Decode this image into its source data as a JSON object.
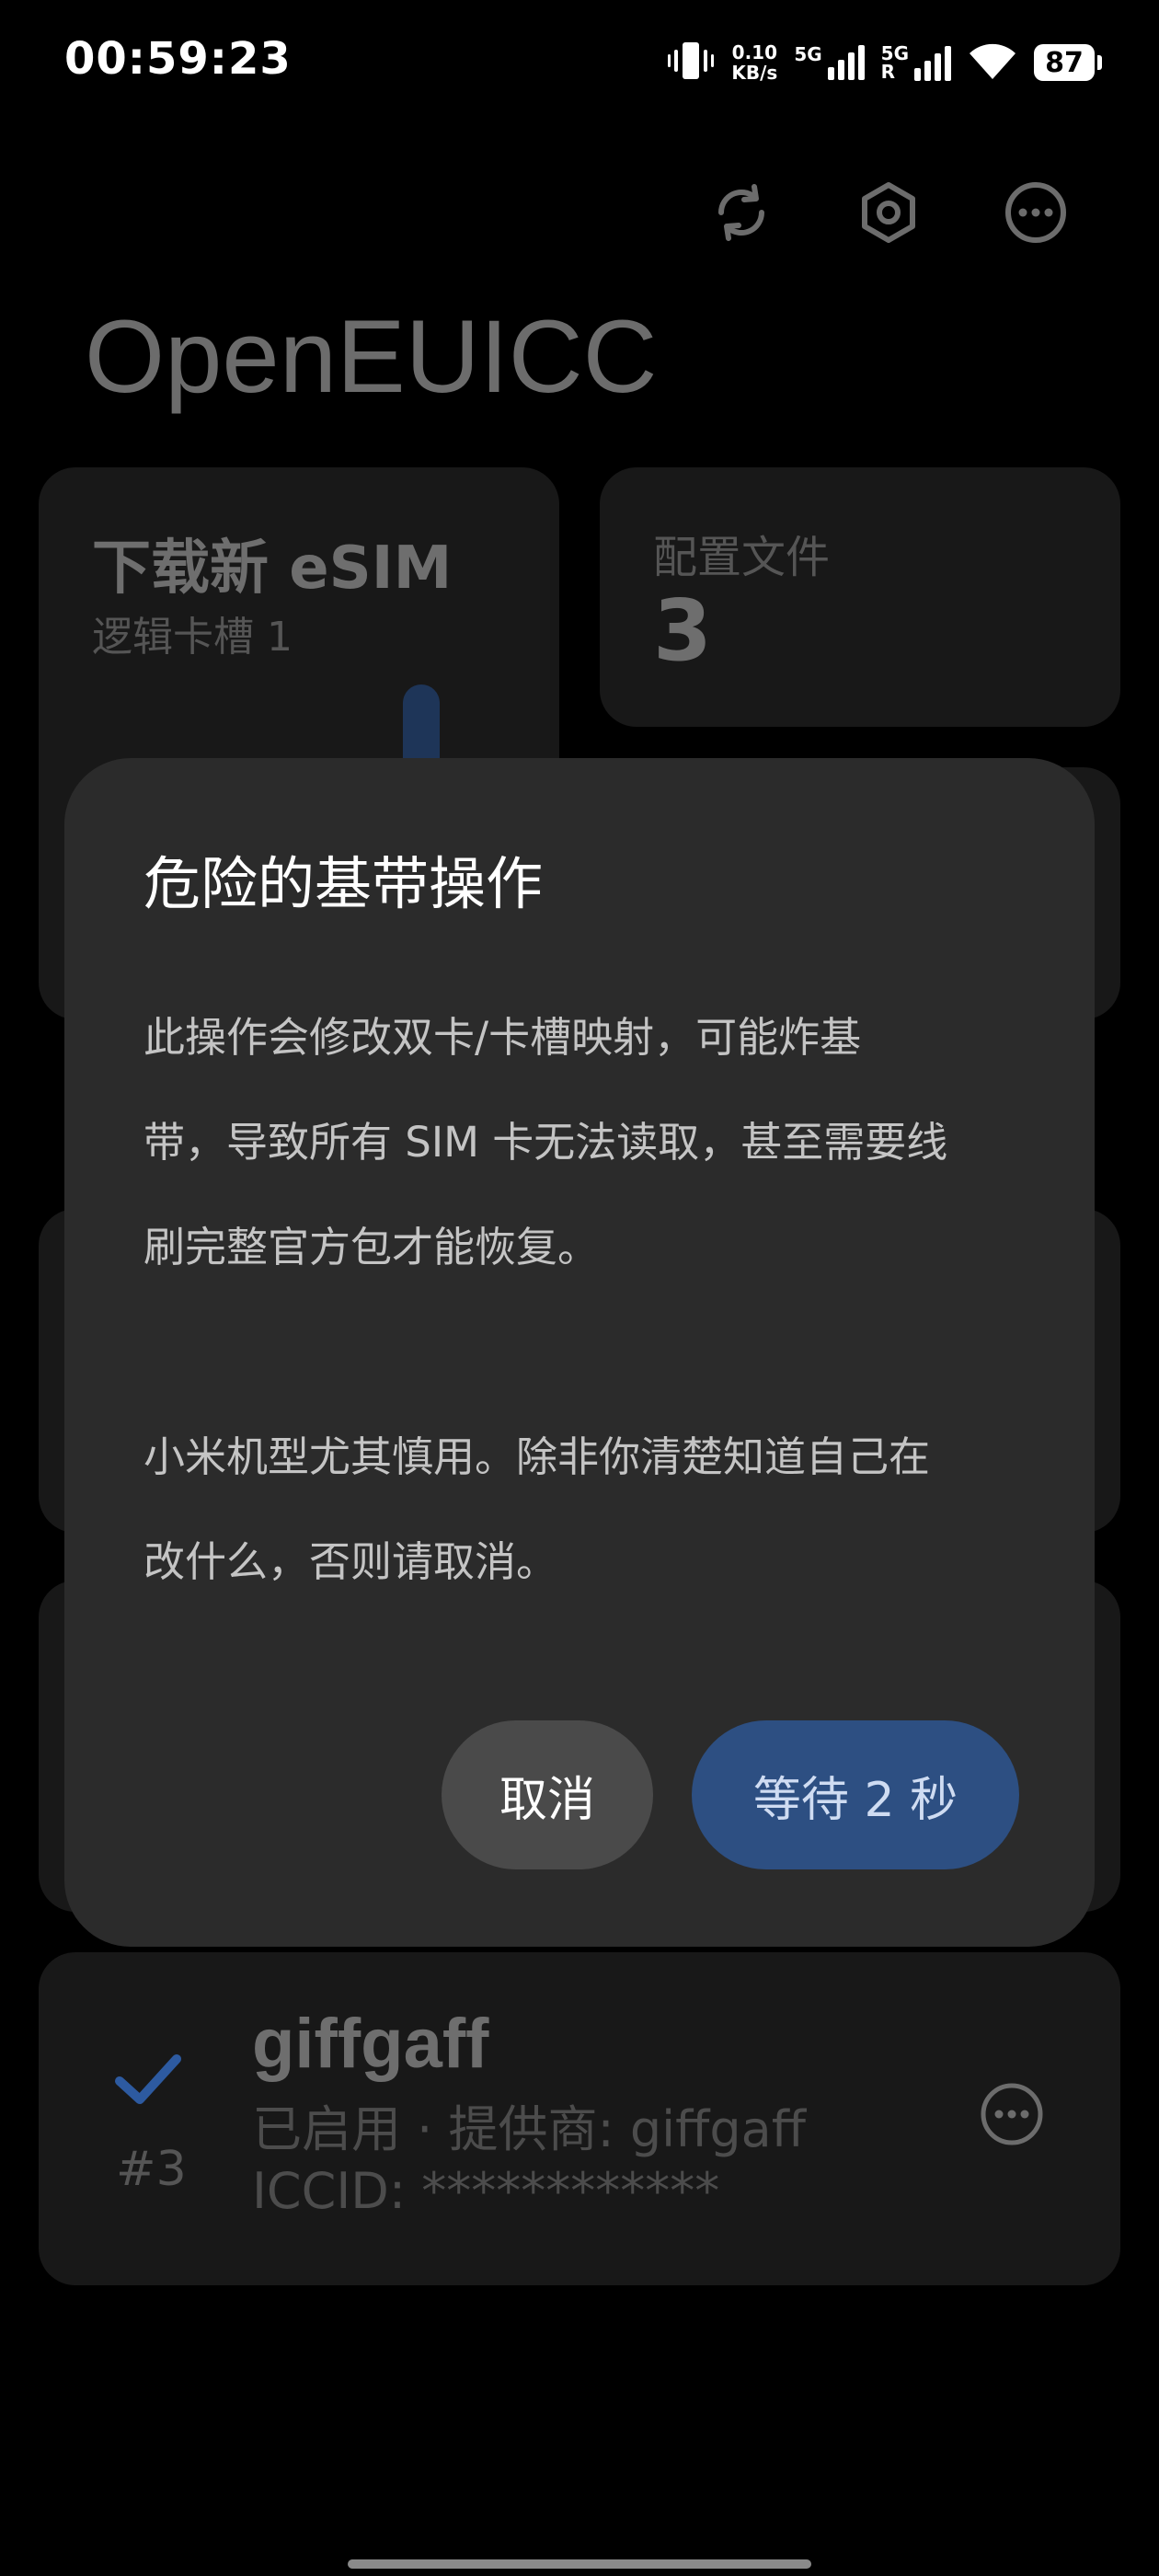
{
  "status_bar": {
    "time": "00:59:23",
    "net_speed_value": "0.10",
    "net_speed_unit": "KB/s",
    "sim1_label": "5G",
    "sim2_label": "5G",
    "sim2_roaming": "R",
    "battery": "87"
  },
  "toolbar": {
    "icons": [
      "refresh-icon",
      "settings-icon",
      "more-icon"
    ]
  },
  "app": {
    "title": "OpenEUICC"
  },
  "cards": {
    "download": {
      "title": "下载新 eSIM",
      "subtitle": "逻辑卡槽 1"
    },
    "profiles": {
      "label": "配置文件",
      "count": "3"
    }
  },
  "profile_item": {
    "name": "giffgaff",
    "status_line": "已启用 · 提供商: giffgaff",
    "iccid": "ICCID: ************",
    "index": "#3"
  },
  "dialog": {
    "title": "危险的基带操作",
    "body": "此操作会修改双卡/卡槽映射，可能炸基带，导致所有 SIM 卡无法读取，甚至需要线刷完整官方包才能恢复。\n\n小米机型尤其慎用。除非你清楚知道自己在改什么，否则请取消。",
    "body_line1": "此操作会修改双卡/卡槽映射，可能炸基",
    "body_line2": "带，导致所有 SIM 卡无法读取，甚至需要线",
    "body_line3": "刷完整官方包才能恢复。",
    "body_line4": "小米机型尤其慎用。除非你清楚知道自己在",
    "body_line5": "改什么，否则请取消。",
    "cancel_label": "取消",
    "wait_label": "等待 2 秒"
  },
  "colors": {
    "background": "#000000",
    "dialog": "#2b2b2b",
    "accent_button": "#2d4f82",
    "check_accent": "#2d5aa0"
  }
}
